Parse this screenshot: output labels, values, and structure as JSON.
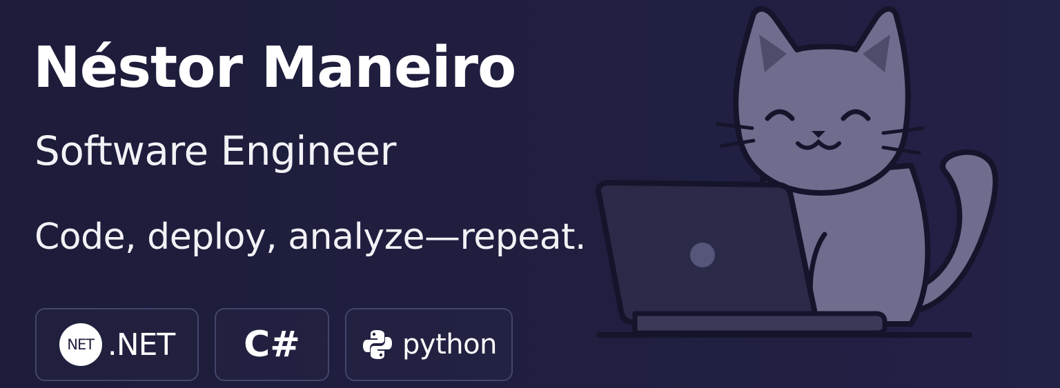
{
  "header": {
    "name": "Néstor Maneiro",
    "role": "Software Engineer",
    "tagline": "Code, deploy, analyze—repeat."
  },
  "tech": [
    {
      "badge_text": "NET",
      "label": ".NET",
      "icon": "dotnet-icon"
    },
    {
      "label": "C#"
    },
    {
      "label": "python",
      "icon": "python-logo-icon"
    }
  ],
  "illustration": {
    "subject": "cat-with-laptop-icon"
  },
  "colors": {
    "background": "#1f1e3c",
    "cat": "#6e6d8e",
    "laptop": "#2b2a48",
    "outline": "#15142b",
    "text": "#ffffff",
    "chip_border": "#45446a"
  }
}
